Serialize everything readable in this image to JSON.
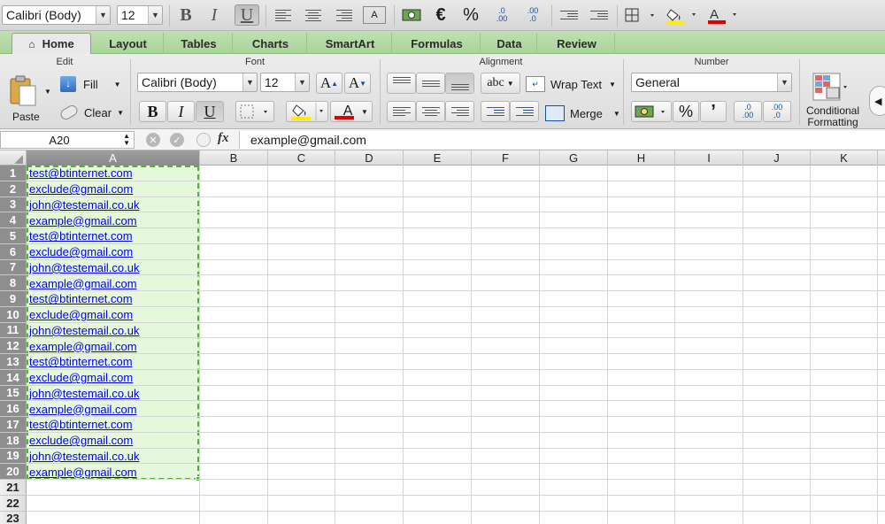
{
  "toolbar": {
    "font_name": "Calibri (Body)",
    "font_size": "12",
    "bold": "B",
    "italic": "I",
    "underline": "U",
    "euro": "€",
    "percent": "%",
    "dec_increase": ".00",
    "dec_decrease": ".0"
  },
  "tabs": [
    "Home",
    "Layout",
    "Tables",
    "Charts",
    "SmartArt",
    "Formulas",
    "Data",
    "Review"
  ],
  "ribbon": {
    "edit": {
      "title": "Edit",
      "paste": "Paste",
      "fill": "Fill",
      "clear": "Clear"
    },
    "font": {
      "title": "Font",
      "name": "Calibri (Body)",
      "size": "12",
      "bold": "B",
      "italic": "I",
      "underline": "U",
      "grow": "A",
      "shrink": "A",
      "color_letter": "A"
    },
    "alignment": {
      "title": "Alignment",
      "abc": "abc",
      "wrap_text": "Wrap Text",
      "merge": "Merge"
    },
    "number": {
      "title": "Number",
      "format": "General",
      "percent": "%",
      "comma": "’"
    },
    "conditional": {
      "line1": "Conditional",
      "line2": "Formatting"
    }
  },
  "formula_bar": {
    "cell_ref": "A20",
    "fx": "fx",
    "value": "example@gmail.com"
  },
  "grid": {
    "columns": [
      "A",
      "B",
      "C",
      "D",
      "E",
      "F",
      "G",
      "H",
      "I",
      "J",
      "K"
    ],
    "rows": [
      "1",
      "2",
      "3",
      "4",
      "5",
      "6",
      "7",
      "8",
      "9",
      "10",
      "11",
      "12",
      "13",
      "14",
      "15",
      "16",
      "17",
      "18",
      "19",
      "20",
      "21",
      "22",
      "23"
    ],
    "column_a": [
      "test@btinternet.com",
      "exclude@gmail.com",
      "john@testemail.co.uk",
      "example@gmail.com",
      "test@btinternet.com",
      "exclude@gmail.com",
      "john@testemail.co.uk",
      "example@gmail.com",
      "test@btinternet.com",
      "exclude@gmail.com",
      "john@testemail.co.uk",
      "example@gmail.com",
      "test@btinternet.com",
      "exclude@gmail.com",
      "john@testemail.co.uk",
      "example@gmail.com",
      "test@btinternet.com",
      "exclude@gmail.com",
      "john@testemail.co.uk",
      "example@gmail.com"
    ]
  },
  "colors": {
    "ribbon_tabs": "#a9d49a",
    "selection_fill": "#e6f8dc",
    "selection_border": "#4fb332",
    "link": "#0000ee",
    "highlight_yellow": "#ffee00",
    "font_red": "#e00000"
  }
}
